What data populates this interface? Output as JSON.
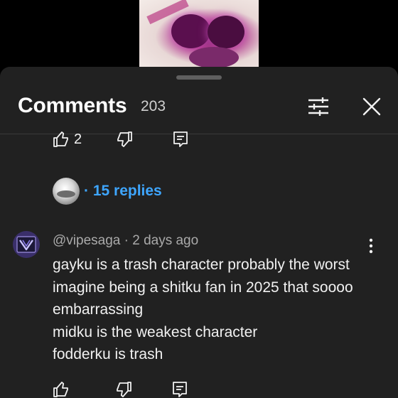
{
  "header": {
    "title": "Comments",
    "count": "203"
  },
  "previous_comment": {
    "like_count": "2",
    "replies_label": "· 15 replies"
  },
  "comment": {
    "author": "@vipesaga",
    "separator": "·",
    "time": "2 days ago",
    "lines": [
      "gayku is a trash character probably the worst",
      "imagine being a shitku fan in 2025 that soooo",
      "embarrassing",
      "midku is the weakest character",
      "fodderku is trash"
    ]
  },
  "icons": {
    "filter": "filter-sliders-icon",
    "close": "close-icon",
    "like": "thumbs-up-icon",
    "dislike": "thumbs-down-icon",
    "reply": "reply-comment-icon",
    "more": "more-vertical-icon"
  },
  "colors": {
    "sheet_background": "#212121",
    "link": "#3ea6ff",
    "secondary_text": "#aaaaaa"
  }
}
